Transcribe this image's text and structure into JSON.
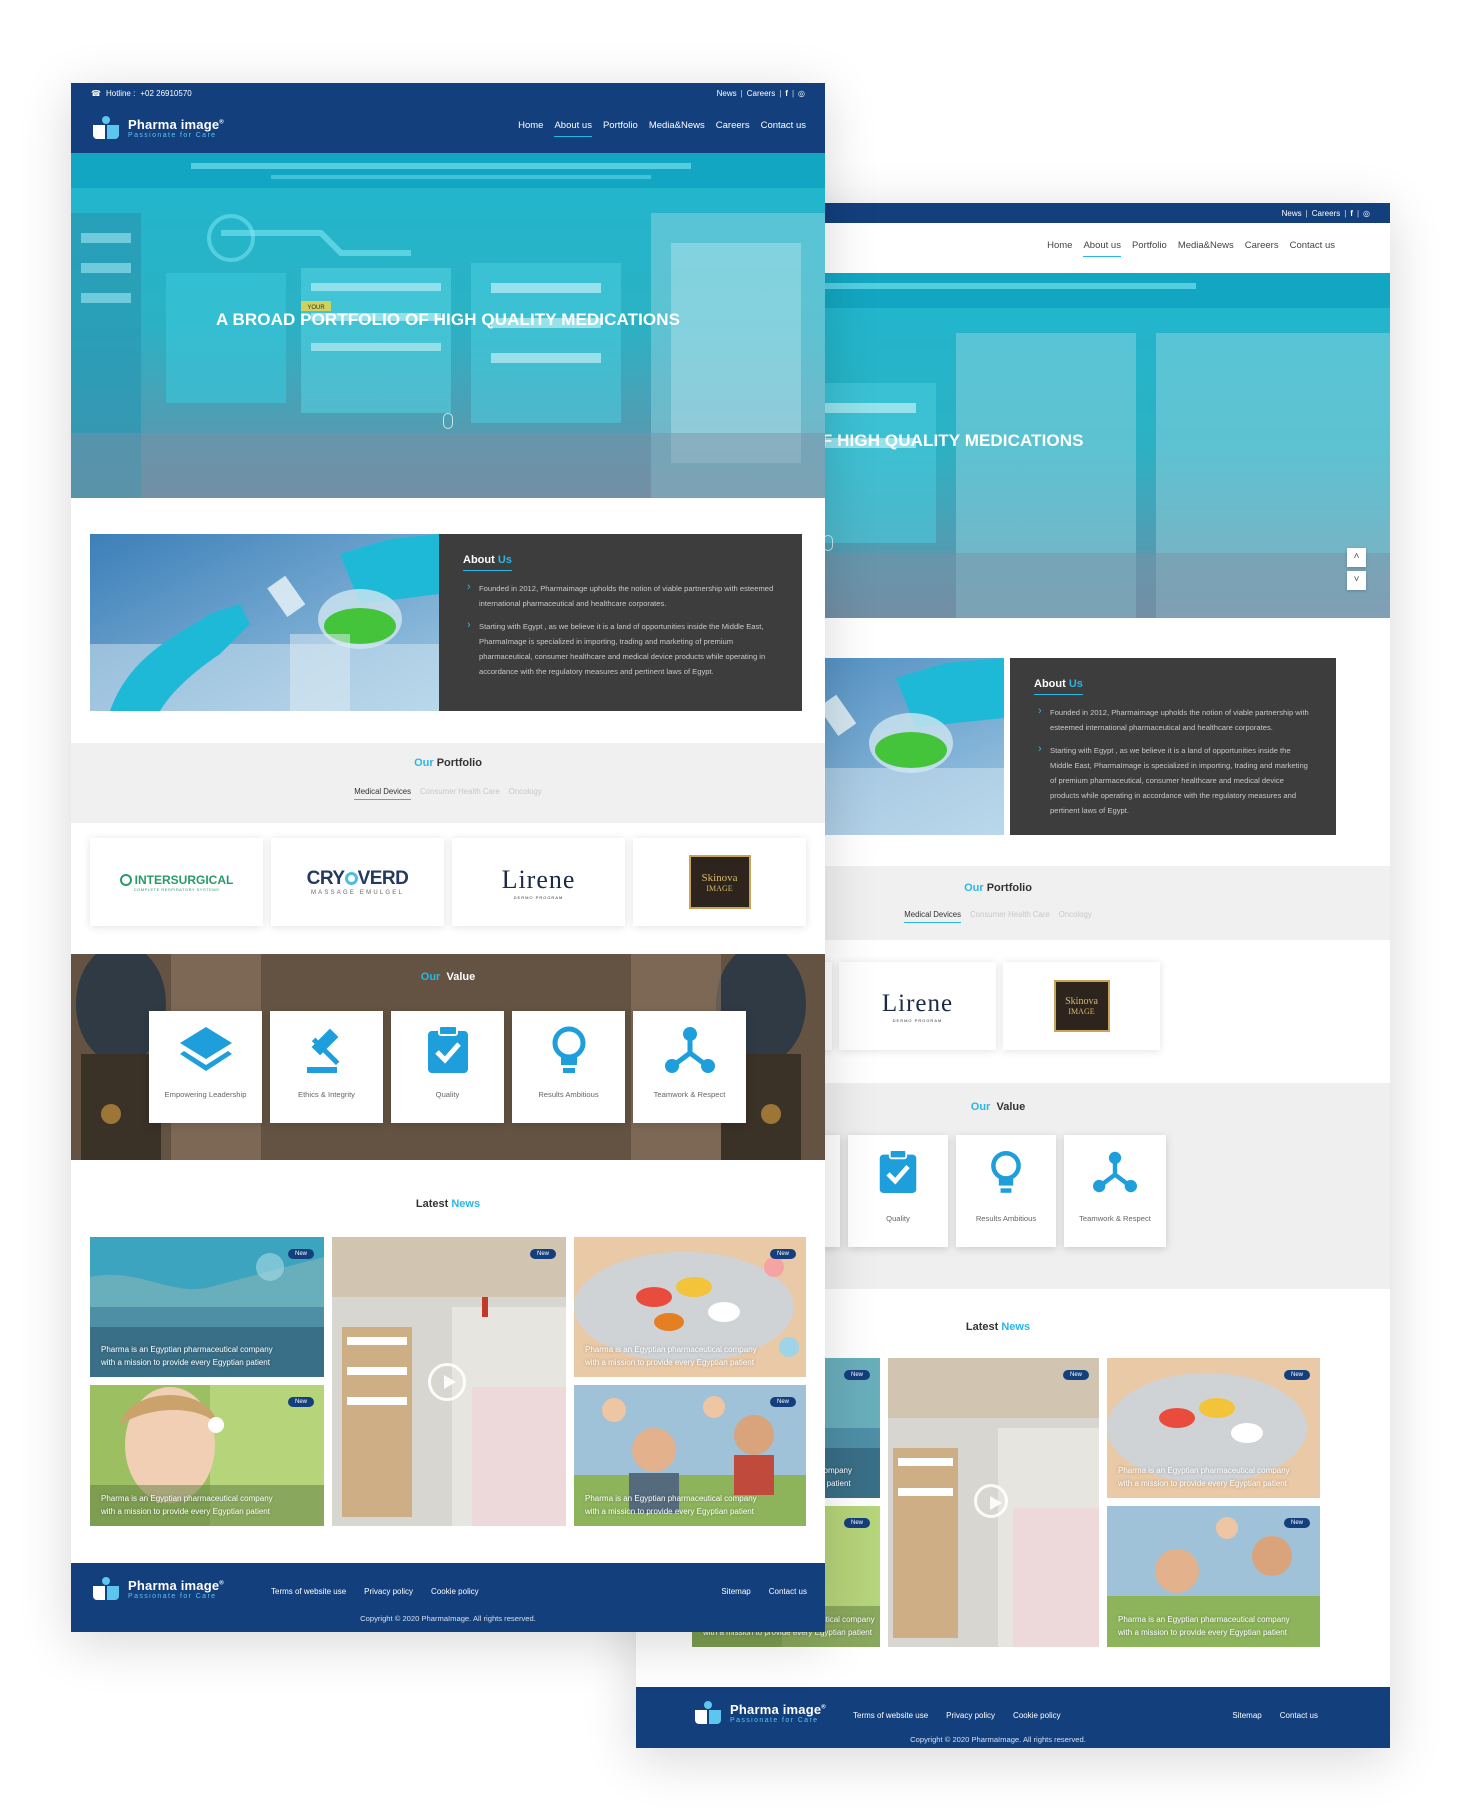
{
  "site": {
    "brand_name": "Pharma image",
    "brand_tagline": "Passionate for Care",
    "brand_registered": "®"
  },
  "topbar": {
    "hotline_label": "Hotline :",
    "hotline_number": "+02 26910570",
    "news": "News",
    "careers": "Careers",
    "facebook_icon": "f",
    "instagram_icon": "◎"
  },
  "nav": [
    {
      "label": "Home"
    },
    {
      "label": "About us"
    },
    {
      "label": "Portfolio"
    },
    {
      "label": "Media&News"
    },
    {
      "label": "Careers"
    },
    {
      "label": "Contact us"
    }
  ],
  "hero": {
    "title": "A BROAD PORTFOLIO OF HIGH QUALITY MEDICATIONS",
    "title_cropped": "BROAD PORTFOLIO OF HIGH QUALITY MEDICATIONS",
    "sign": "YOUR"
  },
  "about": {
    "title_a": "About",
    "title_b": "Us",
    "p1": "Founded in 2012, Pharmaimage upholds the notion of viable partnership with esteemed international pharmaceutical and healthcare corporates.",
    "p2": "Starting with Egypt , as we believe it is a land of opportunities inside the Middle East, PharmaImage is specialized in importing, trading and marketing of premium pharmaceutical, consumer healthcare and medical device products while operating in accordance with the regulatory measures and pertinent laws of Egypt."
  },
  "portfolio": {
    "title_a": "Our",
    "title_b": "Portfolio",
    "tabs": [
      "Medical Devices",
      "Consumer Health Care",
      "Oncology"
    ],
    "brands": {
      "intersurgical": "INTERSURGICAL",
      "intersurgical_sub": "COMPLETE RESPIRATORY SYSTEMS",
      "cryoverd_a": "CRY",
      "cryoverd_b": "VERD",
      "cryoverd_sub": "MASSAGE EMULGEL",
      "lirene": "Lirene",
      "lirene_sub": "DERMO PROGRAM",
      "skinova_a": "Skinova",
      "skinova_b": "IMAGE"
    }
  },
  "values": {
    "title_a": "Our",
    "title_b": "Value",
    "items": [
      {
        "label": "Empowering Leadership",
        "icon": "layers-icon"
      },
      {
        "label": "Ethics & Integrity",
        "icon": "gavel-icon"
      },
      {
        "label": "Quality",
        "icon": "clipboard-check-icon"
      },
      {
        "label": "Results Ambitious",
        "icon": "lightbulb-icon"
      },
      {
        "label": "Teamwork & Respect",
        "icon": "network-icon"
      }
    ],
    "cropped_label": "ip"
  },
  "news": {
    "title_a": "Latest",
    "title_b": "News",
    "badge": "New",
    "caption_1": "Pharma is an Egyptian pharmaceutical company",
    "caption_2": "with a mission to provide every Egyptian patient",
    "cropped_1": "cal company",
    "cropped_2": "ation patient"
  },
  "footer": {
    "terms": "Terms of website use",
    "privacy": "Privacy policy",
    "cookie": "Cookie policy",
    "sitemap": "Sitemap",
    "contact": "Contact us",
    "copyright": "Copyright © 2020 PharmaImage. All rights reserved."
  },
  "colors": {
    "navy": "#133f7d",
    "accent": "#29b7e6",
    "dark_box": "#3d3d3d"
  }
}
